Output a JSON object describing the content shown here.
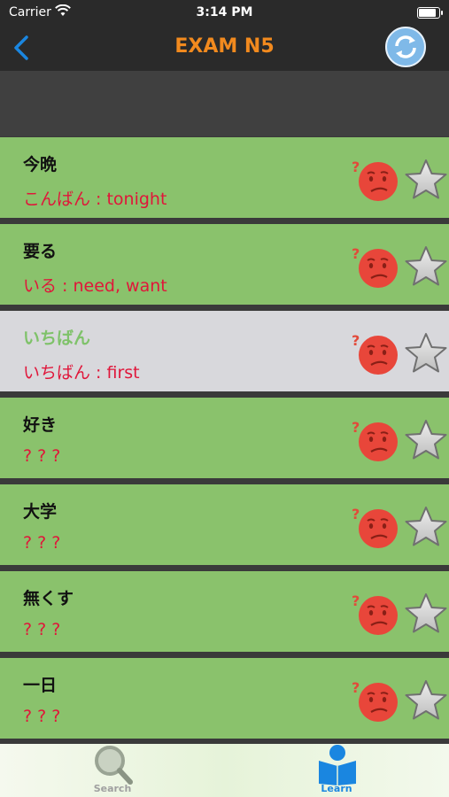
{
  "status": {
    "carrier": "Carrier",
    "time": "3:14 PM",
    "battery_level": 0.95
  },
  "nav": {
    "title": "EXAM N5",
    "back_icon": "chevron-left-icon",
    "refresh_icon": "refresh-icon"
  },
  "colors": {
    "title": "#f28a1e",
    "card_green": "#8ac26c",
    "card_selected": "#d8d8dc",
    "meaning_red": "#e0163a",
    "accent_blue": "#1a86e0"
  },
  "cards": [
    {
      "word": "今晩",
      "meaning": "こんばん : tonight",
      "selected": false
    },
    {
      "word": "要る",
      "meaning": "いる : need, want",
      "selected": false
    },
    {
      "word": "いちばん",
      "meaning": "いちばん : first",
      "selected": true
    },
    {
      "word": "好き",
      "meaning": "? ? ?",
      "selected": false
    },
    {
      "word": "大学",
      "meaning": "? ? ?",
      "selected": false
    },
    {
      "word": "無くす",
      "meaning": "? ? ?",
      "selected": false
    },
    {
      "word": "一日",
      "meaning": "? ? ?",
      "selected": false
    }
  ],
  "tabs": [
    {
      "label": "Search",
      "icon": "magnifier-icon",
      "active": false
    },
    {
      "label": "Learn",
      "icon": "reader-icon",
      "active": true
    }
  ]
}
